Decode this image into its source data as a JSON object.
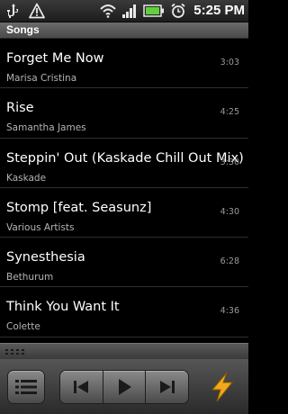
{
  "status_bar": {
    "time": "5:25 PM",
    "left_icons": [
      "usb-icon",
      "warning-icon"
    ],
    "right_icons": [
      "wifi-icon",
      "signal-icon",
      "battery-icon",
      "alarm-icon"
    ]
  },
  "header": {
    "title": "Songs"
  },
  "songs": [
    {
      "title": "Forget Me Now",
      "artist": "Marisa Cristina",
      "duration": "3:03"
    },
    {
      "title": "Rise",
      "artist": "Samantha James",
      "duration": "4:25"
    },
    {
      "title": "Steppin' Out (Kaskade Chill Out Mix)",
      "artist": "Kaskade",
      "duration": "3:30"
    },
    {
      "title": "Stomp [feat. Seasunz]",
      "artist": "Various Artists",
      "duration": "4:30"
    },
    {
      "title": "Synesthesia",
      "artist": "Bethurum",
      "duration": "6:28"
    },
    {
      "title": "Think You Want It",
      "artist": "Colette",
      "duration": "4:36"
    }
  ],
  "controls": {
    "icons": [
      "list-icon",
      "previous-icon",
      "play-icon",
      "next-icon",
      "lightning-icon"
    ]
  },
  "colors": {
    "background": "#000000",
    "accent_bolt": "#f2a81d",
    "battery_green": "#5fd13a"
  }
}
